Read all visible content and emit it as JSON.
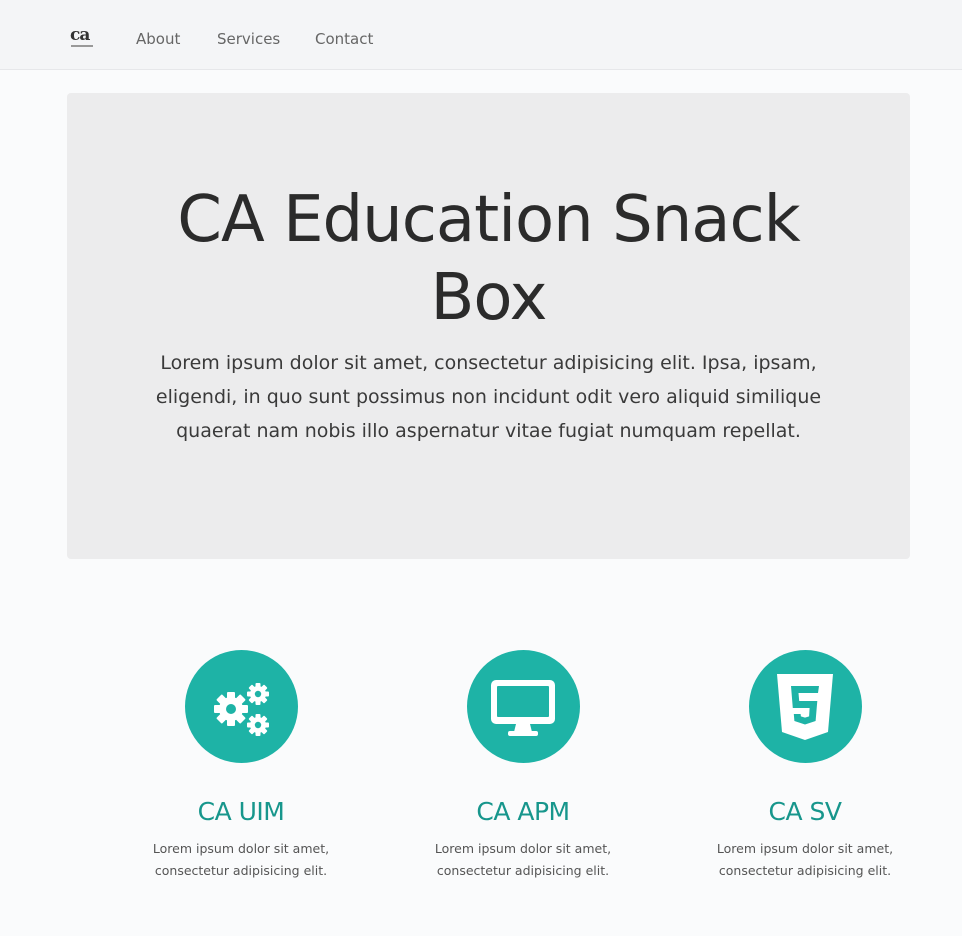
{
  "nav": {
    "brand": "ca",
    "links": [
      {
        "label": "About"
      },
      {
        "label": "Services"
      },
      {
        "label": "Contact"
      }
    ]
  },
  "hero": {
    "title_line1": "CA Education Snack",
    "title_line2": "Box",
    "text": "Lorem ipsum dolor sit amet, consectetur adipisicing elit. Ipsa, ipsam, eligendi, in quo sunt possimus non incidunt odit vero aliquid similique quaerat nam nobis illo aspernatur vitae fugiat numquam repellat."
  },
  "features": [
    {
      "icon": "gears-icon",
      "title": "CA UIM",
      "text_line1": "Lorem ipsum dolor sit amet,",
      "text_line2": "consectetur adipisicing elit."
    },
    {
      "icon": "desktop-icon",
      "title": "CA APM",
      "text_line1": "Lorem ipsum dolor sit amet,",
      "text_line2": "consectetur adipisicing elit."
    },
    {
      "icon": "html5-icon",
      "title": "CA SV",
      "text_line1": "Lorem ipsum dolor sit amet,",
      "text_line2": "consectetur adipisicing elit."
    }
  ],
  "colors": {
    "accent": "#1eb3a6",
    "accent_text": "#17968c",
    "jumbotron_bg": "#ececed",
    "navbar_bg": "#f4f5f7"
  }
}
